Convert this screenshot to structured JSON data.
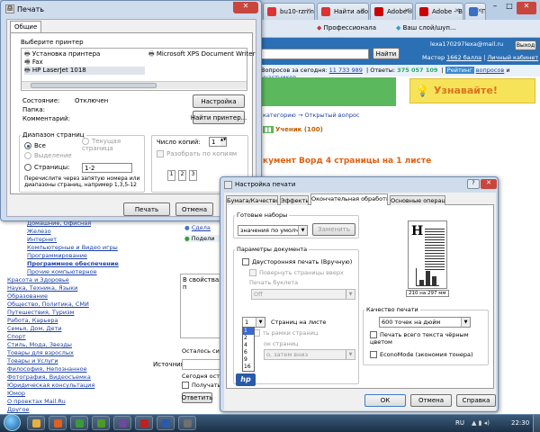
{
  "browser": {
    "tabs": [
      {
        "label": "bu10-rzn.narod",
        "icon": "yandex-icon",
        "color": "#d33"
      },
      {
        "label": "Найти adobe",
        "icon": "search-icon",
        "color": "#d33"
      },
      {
        "label": "Adobe® Ph",
        "icon": "adobe-icon",
        "color": "#c00"
      },
      {
        "label": "Adobe - Вхо",
        "icon": "adobe-icon",
        "color": "#c00"
      },
      {
        "label": "Портал сооб",
        "icon": "portal-icon",
        "color": "#3a6fc4"
      }
    ]
  },
  "page": {
    "toolbar_items": [
      "Профессионала",
      "Ваш слой/шуп..."
    ],
    "user_email": "lexa170297lexa@mail.ru",
    "logout_label": "Выход",
    "search_button": "Найти",
    "master_text": "Мастер",
    "master_points": "1662 балла",
    "personal_cabinet": "Личный кабинет",
    "questions_label": "Вопросов за сегодня:",
    "questions_count": "11 733 989",
    "answers_label": "Ответы:",
    "answers_count": "375 057 109",
    "rating_text": "Рейтинг",
    "rating_questions": "вопросов",
    "rating_and": "и",
    "rating_participants": "участников",
    "banner_text": "Узнавайте!",
    "breadcrumb": "категорию → Открытый вопрос",
    "student_badge": "Ученик (100)",
    "question_title": "кумент Ворд 4 страницы на 1 листе",
    "sidebar_links": [
      "Домашние, Офисная",
      "Железо",
      "Интернет",
      "Компьютерные и Видео игры",
      "Программирование",
      "Программное обеспечение",
      "Прочие компьютерное",
      "Красота и Здоровье",
      "Наука, Техника, Языки",
      "Образование",
      "Общество, Политика, СМИ",
      "Путешествия, Туризм",
      "Работа, Карьера",
      "Семья, Дом, Дети",
      "Спорт",
      "Стиль, Мода, Звезды",
      "Товары для взрослых",
      "Товары и Услуги",
      "Философия, Непознанное",
      "Фотография, Видеосъемка",
      "Юридическая консультация",
      "Юмор",
      "О проектах Mail.Ru",
      "Другое"
    ],
    "bold_sidebar_index": 5,
    "side_links": [
      "Сдела",
      "Подели"
    ],
    "answer_box_text": "В свойствах п",
    "remain_text": "Осталось симв",
    "source_label": "Источник:",
    "today_text": "Сегодня оста",
    "receive_label": "Получать",
    "answer_button": "Ответить"
  },
  "print_dialog": {
    "title": "Печать",
    "tab_general": "Общие",
    "select_printer_label": "Выберите принтер",
    "printers": [
      {
        "name": "Установка принтера",
        "icon": "add-printer-icon"
      },
      {
        "name": "Fax",
        "icon": "fax-icon"
      },
      {
        "name": "HP LaserJet 1018",
        "icon": "printer-icon"
      },
      {
        "name": "Microsoft XPS Document Writer",
        "icon": "printer-icon"
      }
    ],
    "selected_printer": "HP LaserJet 1018",
    "status_label": "Состояние:",
    "status_value": "Отключен",
    "folder_label": "Папка:",
    "comment_label": "Комментарий:",
    "settings_button": "Настройка",
    "find_printer_button": "Найти принтер...",
    "range_title": "Диапазон страниц",
    "range_all": "Все",
    "range_selection": "Выделение",
    "range_current": "Текущая страница",
    "range_pages": "Страницы:",
    "pages_value": "1-2",
    "range_hint": "Перечислите через запятую номера или диапазоны страниц, например 1,3,5-12",
    "copies_label": "Число копий:",
    "copies_value": "1",
    "collate_label": "Разобрать по копиям",
    "collate_pages": [
      "1",
      "2",
      "3"
    ],
    "print_button": "Печать",
    "cancel_button": "Отмена"
  },
  "printer_settings": {
    "title": "Настройка печати",
    "help_icon": "?",
    "tabs": [
      "Бумага/Качество",
      "Эффекты",
      "Окончательная обработка",
      "Основные операции"
    ],
    "active_tab_index": 2,
    "presets_title": "Готовые наборы",
    "preset_value": "значения по умолча",
    "change_button": "Заменить",
    "doc_params_title": "Параметры документа",
    "duplex_label": "Двусторонняя печать (Вручную)",
    "flip_up_label": "Повернуть страницы вверх",
    "booklet_label": "Печать буклета",
    "booklet_value": "Off",
    "pages_per_sheet_value": "1",
    "pages_per_sheet_label": "Страниц на листе",
    "pages_per_sheet_options": [
      "1",
      "2",
      "4",
      "6",
      "9",
      "16"
    ],
    "highlighted_option_index": 0,
    "border_label": "ть рамки страниц",
    "order_label": "ок страниц",
    "order_value": "о, затем вниз",
    "paper_size_label": "210 на 297 мм",
    "quality_title": "Качество печати",
    "quality_value": "600 точек на дюйм",
    "black_text_label": "Печать всего текста чёрным цветом",
    "economode_label": "EconoMode (экономия тонера)",
    "logo_text": "hp",
    "ok_button": "ОК",
    "cancel_button": "Отмена",
    "help_button": "Справка"
  },
  "taskbar": {
    "language": "RU",
    "time": "22:30",
    "apps": [
      {
        "name": "explorer-icon",
        "color": "#e8b040"
      },
      {
        "name": "firefox-icon",
        "color": "#e06020"
      },
      {
        "name": "chrome-icon",
        "color": "#3a9a3a"
      },
      {
        "name": "utorrent-icon",
        "color": "#4a9a2a"
      },
      {
        "name": "media-icon",
        "color": "#6a4a9a"
      },
      {
        "name": "mail-ru-agent-icon",
        "color": "#c02020"
      },
      {
        "name": "word-icon",
        "color": "#2a5aaa"
      },
      {
        "name": "settings-app-icon",
        "color": "#707070"
      }
    ]
  }
}
